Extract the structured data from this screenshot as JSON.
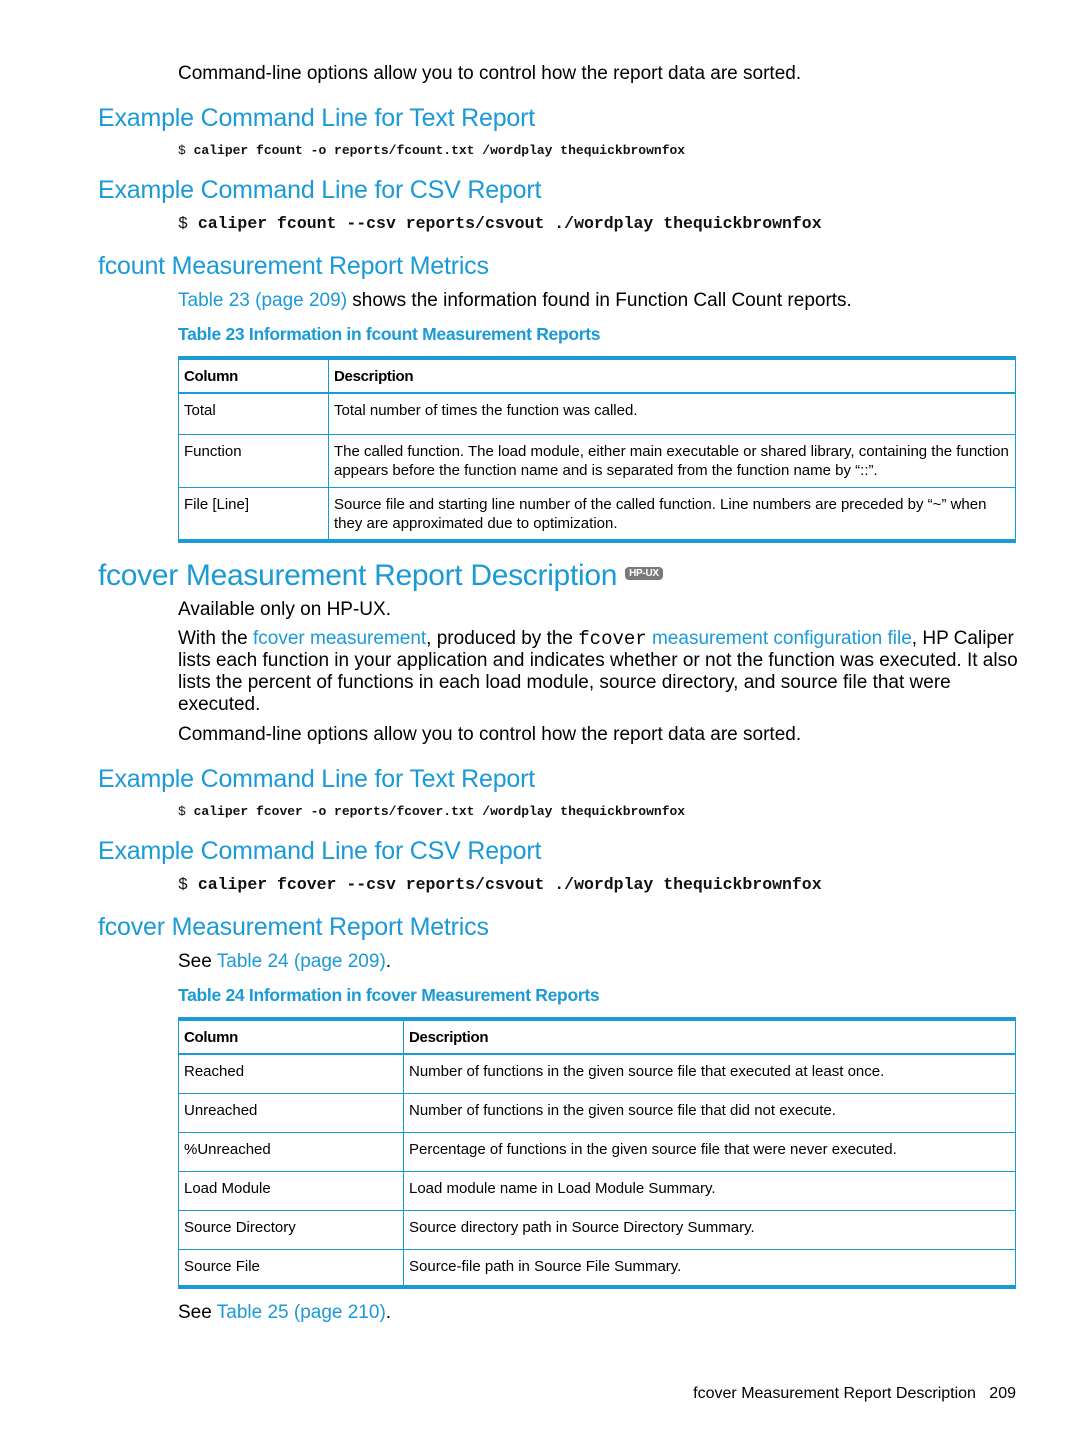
{
  "intro_sort_text": "Command-line options allow you to control how the report data are sorted.",
  "fcount": {
    "text_report_heading": "Example Command Line for Text Report",
    "text_report_cmd_prompt": "$",
    "text_report_cmd": "caliper fcount -o reports/fcount.txt /wordplay thequickbrownfox",
    "csv_report_heading": "Example Command Line for CSV Report",
    "csv_report_cmd_prompt": "$",
    "csv_report_cmd": "caliper fcount --csv reports/csvout ./wordplay thequickbrownfox",
    "metrics_heading": "fcount Measurement Report Metrics",
    "metrics_link": "Table 23 (page 209)",
    "metrics_text": " shows the information found in Function Call Count reports.",
    "table_caption": "Table 23 Information in fcount Measurement Reports",
    "table": {
      "headers": [
        "Column",
        "Description"
      ],
      "rows": [
        [
          "Total",
          "Total number of times the function was called."
        ],
        [
          "Function",
          "The called function. The load module, either main executable or shared library, containing the function appears before the function name and is separated from the function name by “::”."
        ],
        [
          "File [Line]",
          "Source file and starting line number of the called function. Line numbers are preceded by “~” when they are approximated due to optimization."
        ]
      ]
    }
  },
  "fcover": {
    "section_heading": "fcover Measurement Report Description",
    "platform_badge": "HP-UX",
    "availability": "Available only on HP-UX.",
    "desc_part1": "With the ",
    "desc_link1": "fcover measurement",
    "desc_part2": ", produced by the ",
    "desc_code": "fcover",
    "desc_link2": " measurement configuration file",
    "desc_part3": ", HP Caliper lists each function in your application and indicates whether or not the function was executed. It also lists the percent of functions in each load module, source directory, and source file that were executed.",
    "sort_text": "Command-line options allow you to control how the report data are sorted.",
    "text_report_heading": "Example Command Line for Text Report",
    "text_report_cmd_prompt": "$",
    "text_report_cmd": "caliper fcover -o reports/fcover.txt /wordplay thequickbrownfox",
    "csv_report_heading": "Example Command Line for CSV Report",
    "csv_report_cmd_prompt": "$",
    "csv_report_cmd": "caliper fcover --csv reports/csvout ./wordplay thequickbrownfox",
    "metrics_heading": "fcover Measurement Report Metrics",
    "see_prefix": "See ",
    "see_link": "Table 24 (page 209)",
    "see_suffix": ".",
    "table_caption": "Table 24 Information in fcover Measurement Reports",
    "table": {
      "headers": [
        "Column",
        "Description"
      ],
      "rows": [
        [
          "Reached",
          "Number of functions in the given source file that executed at least once."
        ],
        [
          "Unreached",
          "Number of functions in the given source file that did not execute."
        ],
        [
          "%Unreached",
          "Percentage of functions in the given source file that were never executed."
        ],
        [
          "Load Module",
          "Load module name in Load Module Summary."
        ],
        [
          "Source Directory",
          "Source directory path in Source Directory Summary."
        ],
        [
          "Source File",
          "Source-file path in Source File Summary."
        ]
      ]
    },
    "see2_prefix": "See ",
    "see2_link": "Table 25 (page 210)",
    "see2_suffix": "."
  },
  "footer": {
    "section_title": "fcover Measurement Report Description",
    "page_number": "209"
  }
}
